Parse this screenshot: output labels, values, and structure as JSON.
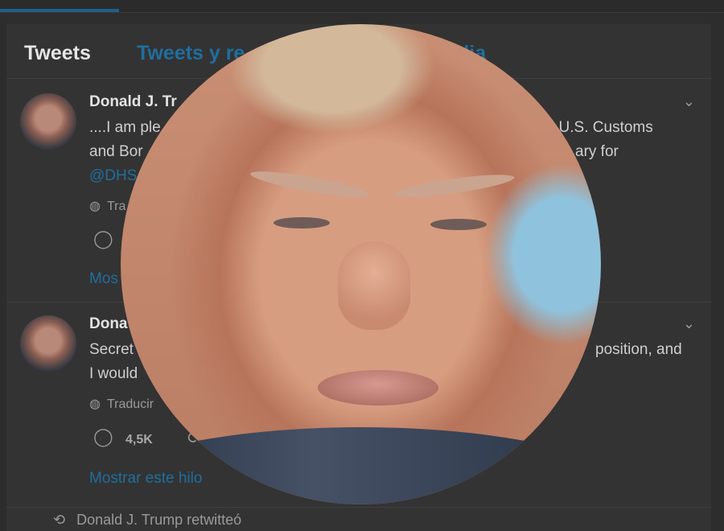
{
  "tabs": {
    "tweets": "Tweets",
    "replies_prefix": "Tweets y re",
    "media_suffix": "dia"
  },
  "tweet1": {
    "author": "Donald J. Tr",
    "line1_left": "....I am ple",
    "line1_right": "t U.S. Customs",
    "line2_left": "and Bor",
    "line2_right": "ary for",
    "mention": "@DHS",
    "translate": "Tra",
    "show_thread": "Mos"
  },
  "tweet2": {
    "author": "Dona",
    "line1_left": "Secret",
    "line1_right": "position, and",
    "line2_left": "I would",
    "translate": "Traducir",
    "reply_count": "4,5K",
    "show_thread": "Mostrar este hilo"
  },
  "retweeted": {
    "text": "Donald J. Trump retwitteó"
  },
  "icons": {
    "chevron": "chevron-down-icon",
    "globe": "globe-icon",
    "reply": "reply-icon",
    "retweet": "retweet-icon"
  },
  "colors": {
    "background": "#2d2d2d",
    "panel": "#333333",
    "link": "#1f6e9e",
    "text": "#cfcfcf"
  }
}
